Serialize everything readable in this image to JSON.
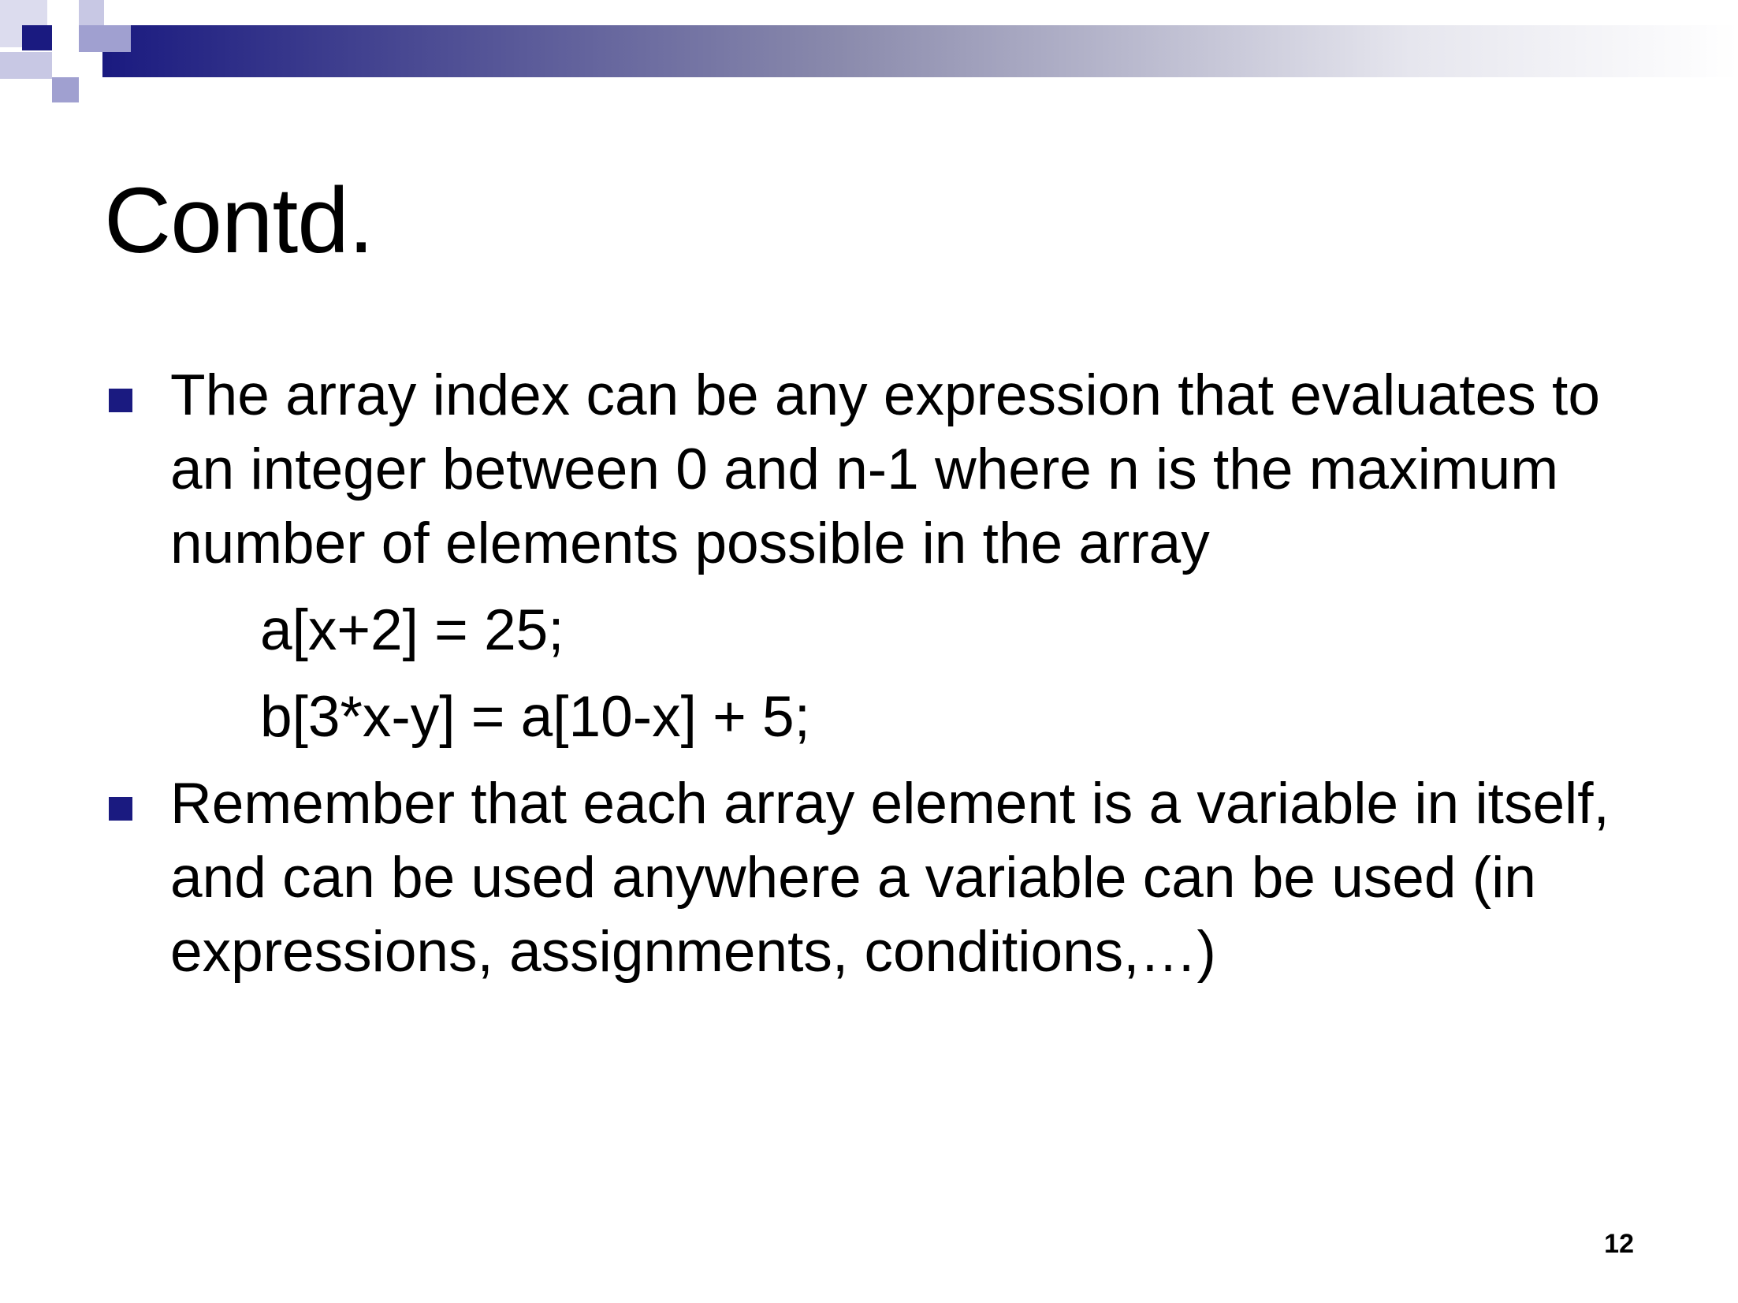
{
  "slide": {
    "title": "Contd.",
    "bullets": [
      {
        "text": "The array index can be any expression that evaluates to an integer between 0 and n-1 where n is the maximum number of elements possible in the array",
        "code": [
          "a[x+2] = 25;",
          "b[3*x-y] = a[10-x] + 5;"
        ]
      },
      {
        "text": "Remember that each array element is a variable in itself, and can be used anywhere a variable can be used (in expressions, assignments, conditions,…)"
      }
    ],
    "page_number": "12"
  },
  "colors": {
    "accent": "#1a1a80",
    "bullet": "#1a1a80",
    "deco_light": "#a0a0d0",
    "deco_mid": "#c8c8e4",
    "text": "#000000"
  },
  "icons": {
    "bullet": "square-bullet-icon"
  }
}
